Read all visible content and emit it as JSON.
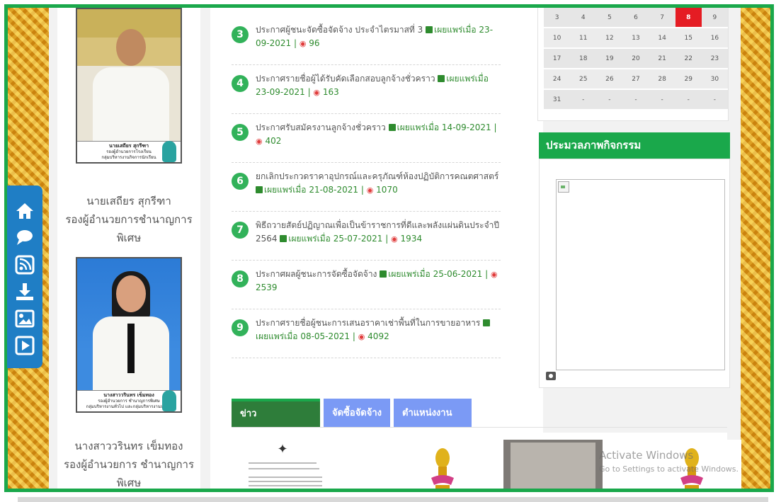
{
  "people": [
    {
      "name": "นายเสถียร สุกรีฑา",
      "role": "รองผู้อำนวยการชำนาญการ",
      "role2": "พิเศษ",
      "caption_name": "นายเสถียร สุกรีฑา",
      "caption_role": "รองผู้อำนวยการโรงเรียน",
      "caption_dept": "กลุ่มบริหารงานกิจการนักเรียน"
    },
    {
      "name": "นางสาววรินทร เข็มทอง",
      "role": "รองผู้อำนวยการ ชำนาญการ",
      "role2": "พิเศษ",
      "caption_name": "นางสาววรินทร เข็มทอง",
      "caption_role": "รองผู้อำนวยการ ชำนาญการพิเศษ",
      "caption_dept": "กลุ่มบริหารงานทั่วไป และกลุ่มบริหารงานบุคคล"
    }
  ],
  "sidebar_icons": [
    "home-icon",
    "chat-icon",
    "rss-icon",
    "download-icon",
    "image-icon",
    "play-icon"
  ],
  "announcements": [
    {
      "num": "3",
      "title": "ประกาศผู้ชนะจัดซื้อจัดจ้าง ประจำไตรมาสที่ 3",
      "published_label": "เผยแพร่เมื่อ",
      "date": "23-09-2021",
      "views": "96"
    },
    {
      "num": "4",
      "title": "ประกาศรายชื่อผู้ได้รับคัดเลือกสอบลูกจ้างชั่วคราว",
      "published_label": "เผยแพร่เมื่อ",
      "date": "23-09-2021",
      "views": "163"
    },
    {
      "num": "5",
      "title": "ประกาศรับสมัครงานลูกจ้างชั่วคราว",
      "published_label": "เผยแพร่เมื่อ",
      "date": "14-09-2021",
      "views": "402"
    },
    {
      "num": "6",
      "title": "ยกเลิกประกวดราคาอุปกรณ์และครุภัณฑ์ห้องปฏิบัติการคณตศาสตร์",
      "published_label": "เผยแพร่เมื่อ",
      "date": "21-08-2021",
      "views": "1070"
    },
    {
      "num": "7",
      "title": "พิธีถวายสัตย์ปฏิญาณเพื่อเป็นข้าราชการที่ดีและพลังแผ่นดินประจำปี 2564",
      "published_label": "เผยแพร่เมื่อ",
      "date": "25-07-2021",
      "views": "1934"
    },
    {
      "num": "8",
      "title": "ประกาศผลผู้ชนะการจัดซื้อจัดจ้าง",
      "published_label": "เผยแพร่เมื่อ",
      "date": "25-06-2021",
      "views": "2539"
    },
    {
      "num": "9",
      "title": "ประกาศรายชื่อผู้ชนะการเสนอราคาเช่าพื้นที่ในการขายอาหาร",
      "published_label": "เผยแพร่เมื่อ",
      "date": "08-05-2021",
      "views": "4092"
    }
  ],
  "tabs": [
    "ข่าวประชาสัมพันธ์",
    "จัดซื้อจัดจ้าง",
    "ตำแหน่งงานว่าง"
  ],
  "calendar": {
    "rows": [
      [
        "3",
        "4",
        "5",
        "6",
        "7",
        "8",
        "9"
      ],
      [
        "10",
        "11",
        "12",
        "13",
        "14",
        "15",
        "16"
      ],
      [
        "17",
        "18",
        "19",
        "20",
        "21",
        "22",
        "23"
      ],
      [
        "24",
        "25",
        "26",
        "27",
        "28",
        "29",
        "30"
      ],
      [
        "31",
        "-",
        "-",
        "-",
        "-",
        "-",
        "-"
      ]
    ],
    "today": "8"
  },
  "gallery": {
    "title": "ประมวลภาพกิจกรรม"
  },
  "watermark": {
    "line1": "Activate Windows",
    "line2": "Go to Settings to activate Windows."
  },
  "colors": {
    "accent_green": "#1aa84b",
    "tab_blue": "#7b9af5",
    "icon_bar": "#1f7ec5",
    "today_red": "#e51c23",
    "view_red": "#e03c3c"
  }
}
